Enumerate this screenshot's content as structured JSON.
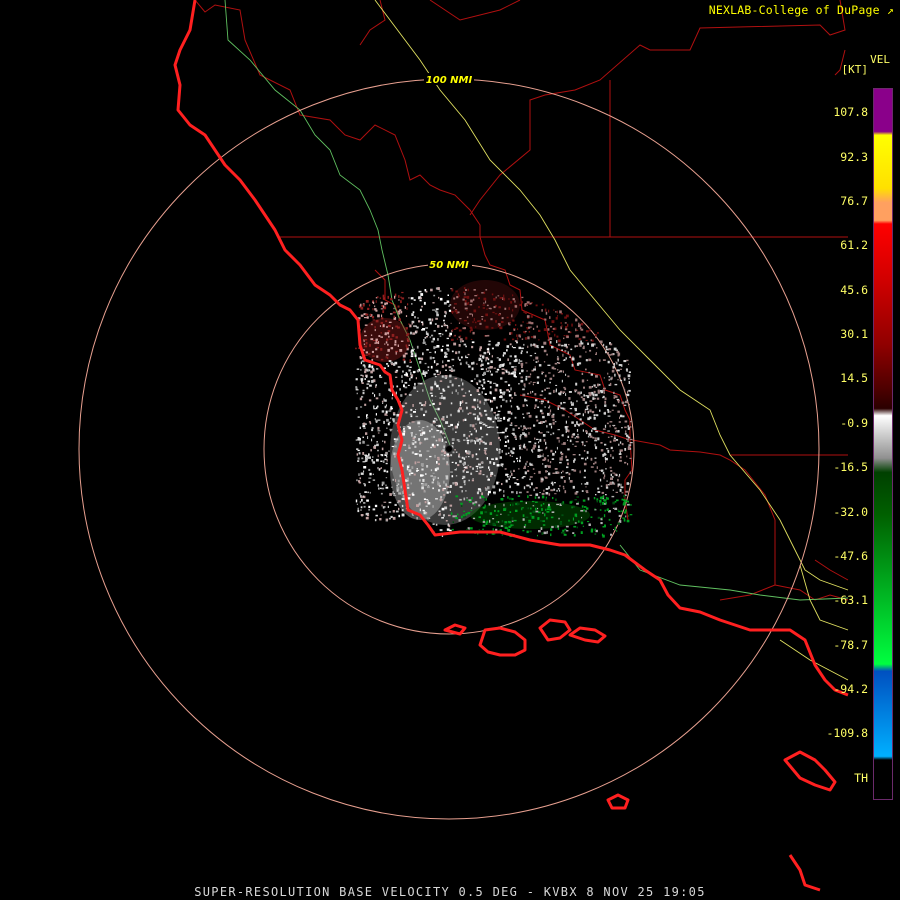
{
  "header": {
    "credit": "NEXLAB-College of DuPage ↗"
  },
  "legend": {
    "product": "VEL",
    "unit": "[KT]",
    "ticks": [
      "107.8",
      "92.3",
      "76.7",
      "61.2",
      "45.6",
      "30.1",
      "14.5",
      "-0.9",
      "-16.5",
      "-32.0",
      "-47.6",
      "-63.1",
      "-78.7",
      "-94.2",
      "-109.8",
      "TH"
    ],
    "colors": [
      "#8a008a",
      "#ffff00",
      "#ffa060",
      "#ff0000",
      "#c00000",
      "#800000",
      "#2a0000",
      "#ffffff",
      "#006000",
      "#00ff40",
      "#0050c0",
      "#00b0ff",
      "#000000"
    ]
  },
  "map": {
    "ring_labels": [
      "100 NMI",
      "50 NMI"
    ],
    "colors": {
      "coast": "#ff2020",
      "county": "#b01010",
      "ring": "#e8a090",
      "river": "#60c060",
      "highway": "#e0e060"
    }
  },
  "footer": {
    "caption": "SUPER-RESOLUTION BASE VELOCITY 0.5 DEG - KVBX 8 NOV 25 19:05"
  }
}
